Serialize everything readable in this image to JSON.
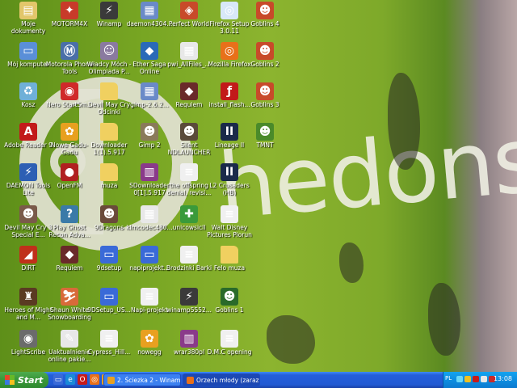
{
  "desktop_icons": [
    {
      "label": "Moje dokumenty",
      "icon": "folder-documents-icon",
      "color": "#e2c66a",
      "glyph": "▤"
    },
    {
      "label": "Mój komputer",
      "icon": "my-computer-icon",
      "color": "#5a8fd8",
      "glyph": "▭"
    },
    {
      "label": "Kosz",
      "icon": "recycle-bin-icon",
      "color": "#6fb0d8",
      "glyph": "♻"
    },
    {
      "label": "Adobe Reader 9",
      "icon": "adobe-reader-icon",
      "color": "#c21a1a",
      "glyph": "A"
    },
    {
      "label": "DAEMON Tools Lite",
      "icon": "daemon-tools-icon",
      "color": "#2d5fb4",
      "glyph": "⚡"
    },
    {
      "label": "Devil May Cry 3 Special E...",
      "icon": "game-icon",
      "color": "#7a5a4a",
      "glyph": "☻"
    },
    {
      "label": "DiRT",
      "icon": "dirt-game-icon",
      "color": "#c0301a",
      "glyph": "◢"
    },
    {
      "label": "Heroes of Might and M...",
      "icon": "heroes-game-icon",
      "color": "#5a3a22",
      "glyph": "♜"
    },
    {
      "label": "LightScribe",
      "icon": "lightscribe-icon",
      "color": "#6b6b6b",
      "glyph": "◉"
    },
    {
      "label": "MOTORM4X",
      "icon": "motorm4x-icon",
      "color": "#c83a2a",
      "glyph": "✦"
    },
    {
      "label": "Motorola Phone Tools",
      "icon": "motorola-icon",
      "color": "#4a6fa8",
      "glyph": "Ⓜ"
    },
    {
      "label": "Nero StartSm...",
      "icon": "nero-icon",
      "color": "#d02a2a",
      "glyph": "◉"
    },
    {
      "label": "Nowe Gadu-Gadu",
      "icon": "gadu-gadu-icon",
      "color": "#e8a020",
      "glyph": "✿"
    },
    {
      "label": "OpenFM",
      "icon": "openfm-icon",
      "color": "#b02020",
      "glyph": "●"
    },
    {
      "label": "Play Ghost Recon Adva...",
      "icon": "ghost-recon-icon",
      "color": "#3a7aa8",
      "glyph": "?"
    },
    {
      "label": "Requiem",
      "icon": "requiem-icon",
      "color": "#6a2a2a",
      "glyph": "◆"
    },
    {
      "label": "Shaun White Snowboarding",
      "icon": "snowboarding-icon",
      "color": "#d86a3a",
      "glyph": "⛷"
    },
    {
      "label": "Uaktualnienie online pakie...",
      "icon": "update-document-icon",
      "color": "#e8e8e8",
      "glyph": "✎"
    },
    {
      "label": "Winamp",
      "icon": "winamp-icon",
      "color": "#3a3a3a",
      "glyph": "⚡"
    },
    {
      "label": "Władcy Móch - Olimpiada P...",
      "icon": "game-icon",
      "color": "#8a7aa0",
      "glyph": "☺"
    },
    {
      "label": "Devil May Cry Odcinki",
      "icon": "folder-icon",
      "color": "#f0d060",
      "glyph": ""
    },
    {
      "label": "Downloader 1(1).5.917",
      "icon": "folder-icon",
      "color": "#f0d060",
      "glyph": ""
    },
    {
      "label": "muza",
      "icon": "folder-icon",
      "color": "#f0d060",
      "glyph": ""
    },
    {
      "label": "9Dragons",
      "icon": "9dragons-icon",
      "color": "#6a4a3a",
      "glyph": "☻"
    },
    {
      "label": "9dsetup",
      "icon": "setup-window-icon",
      "color": "#3a6ad8",
      "glyph": "▭"
    },
    {
      "label": "9DSetup_US...",
      "icon": "setup-window-icon",
      "color": "#3a6ad8",
      "glyph": "▭"
    },
    {
      "label": "Cypress_Hill...",
      "icon": "text-document-icon",
      "color": "#f0f0f0",
      "glyph": "≡"
    },
    {
      "label": "daemon4304...",
      "icon": "installer-icon",
      "color": "#6a8ac8",
      "glyph": "▦"
    },
    {
      "label": "Ether Saga Online",
      "icon": "ether-saga-icon",
      "color": "#2a6ab8",
      "glyph": "◆"
    },
    {
      "label": "gimp-2.6.2...",
      "icon": "gimp-installer-icon",
      "color": "#6a8ac8",
      "glyph": "▦"
    },
    {
      "label": "Gimp 2",
      "icon": "gimp-icon",
      "color": "#8a7a5a",
      "glyph": "☻"
    },
    {
      "label": "SDownloader 0[1].5.917",
      "icon": "winrar-archive-icon",
      "color": "#8a3a8a",
      "glyph": "▥"
    },
    {
      "label": "klmcodec480...",
      "icon": "codec-installer-icon",
      "color": "#e8e8e8",
      "glyph": "▦"
    },
    {
      "label": "napiprojekt...",
      "icon": "setup-window-icon",
      "color": "#3a6ad8",
      "glyph": "▭"
    },
    {
      "label": "Napi-projekt",
      "icon": "text-document-icon",
      "color": "#f0f0f0",
      "glyph": "≡"
    },
    {
      "label": "nowegg",
      "icon": "gadu-gadu-icon",
      "color": "#e8a020",
      "glyph": "✿"
    },
    {
      "label": "Perfect World",
      "icon": "perfect-world-icon",
      "color": "#c84a2a",
      "glyph": "◈"
    },
    {
      "label": "pwi_AllFiles_...",
      "icon": "pwi-installer-icon",
      "color": "#e8e8e8",
      "glyph": "▦"
    },
    {
      "label": "Requiem",
      "icon": "requiem-icon",
      "color": "#6a2a2a",
      "glyph": "◆"
    },
    {
      "label": "Silent NDLAUNCHER",
      "icon": "silent-launcher-icon",
      "color": "#5a4a3a",
      "glyph": "☻"
    },
    {
      "label": "the offspring denial, revisi...",
      "icon": "text-document-icon",
      "color": "#f0f0f0",
      "glyph": "≡"
    },
    {
      "label": "unicowsicll",
      "icon": "dll-icon",
      "color": "#3a9a3a",
      "glyph": "✚"
    },
    {
      "label": "Brodzinki Barki",
      "icon": "text-document-icon",
      "color": "#f0f0f0",
      "glyph": "≡"
    },
    {
      "label": "winamp5552...",
      "icon": "winamp-installer-icon",
      "color": "#3a3a3a",
      "glyph": "⚡"
    },
    {
      "label": "wrar380pl",
      "icon": "winrar-icon",
      "color": "#8a3a8a",
      "glyph": "▥"
    },
    {
      "label": "Firefox Setup 3.0.11",
      "icon": "firefox-setup-icon",
      "color": "#d8e8f8",
      "glyph": "◎"
    },
    {
      "label": "Mozilla Firefox",
      "icon": "firefox-icon",
      "color": "#e8701a",
      "glyph": "◎"
    },
    {
      "label": "install_flash...",
      "icon": "flash-installer-icon",
      "color": "#c21a1a",
      "glyph": "ƒ"
    },
    {
      "label": "Lineage II",
      "icon": "lineage-icon",
      "color": "#1a2a4a",
      "glyph": "II"
    },
    {
      "label": "L2 Crusaders (HB)",
      "icon": "lineage-icon",
      "color": "#1a2a4a",
      "glyph": "II"
    },
    {
      "label": "Walt Disney Pictures Piorun",
      "icon": "text-document-icon",
      "color": "#f0f0f0",
      "glyph": "≡"
    },
    {
      "label": "Felo muza",
      "icon": "folder-icon",
      "color": "#f0d060",
      "glyph": ""
    },
    {
      "label": "Goblins 1",
      "icon": "goblins-icon",
      "color": "#2a6a2a",
      "glyph": "☻"
    },
    {
      "label": "D.M.C opening",
      "icon": "text-document-icon",
      "color": "#f0f0f0",
      "glyph": "≡"
    },
    {
      "label": "Goblins 4",
      "icon": "goblins-icon",
      "color": "#c84a2a",
      "glyph": "☻"
    },
    {
      "label": "Goblins 2",
      "icon": "goblins-icon",
      "color": "#c84a2a",
      "glyph": "☻"
    },
    {
      "label": "Goblins 3",
      "icon": "goblins-icon",
      "color": "#c84a2a",
      "glyph": "☻"
    },
    {
      "label": "TMNT",
      "icon": "tmnt-icon",
      "color": "#4a8a2a",
      "glyph": "☻"
    }
  ],
  "wallpaper": {
    "word": "hedons"
  },
  "taskbar": {
    "start_label": "Start",
    "quick_launch": [
      {
        "icon": "show-desktop-icon",
        "color": "#3a6ad8",
        "glyph": "▭"
      },
      {
        "icon": "internet-explorer-icon",
        "color": "#1a8ad8",
        "glyph": "e"
      },
      {
        "icon": "opera-icon",
        "color": "#c81a1a",
        "glyph": "O"
      },
      {
        "icon": "mozilla-firefox-icon",
        "color": "#e8701a",
        "glyph": "◎"
      },
      {
        "icon": "gadu-gadu-icon",
        "color": "#e8a020",
        "glyph": "✿"
      }
    ],
    "tasks": [
      {
        "label": "2. Ściezka 2 - Winamp",
        "icon": "winamp-icon",
        "color": "#e8a020",
        "active": false
      },
      {
        "label": "Orzech młody (zaraz ...",
        "icon": "firefox-icon",
        "color": "#e8701a",
        "active": true
      }
    ],
    "tray": {
      "language": "PL",
      "icons": [
        {
          "icon": "network-icon",
          "color": "#6ad8f8"
        },
        {
          "icon": "gadu-gadu-tray-icon",
          "color": "#f0c020"
        },
        {
          "icon": "antivirus-icon",
          "color": "#c81a1a"
        },
        {
          "icon": "volume-icon",
          "color": "#e8e8e8"
        },
        {
          "icon": "security-shield-icon",
          "color": "#c82a2a"
        }
      ],
      "clock": "13:08"
    }
  }
}
